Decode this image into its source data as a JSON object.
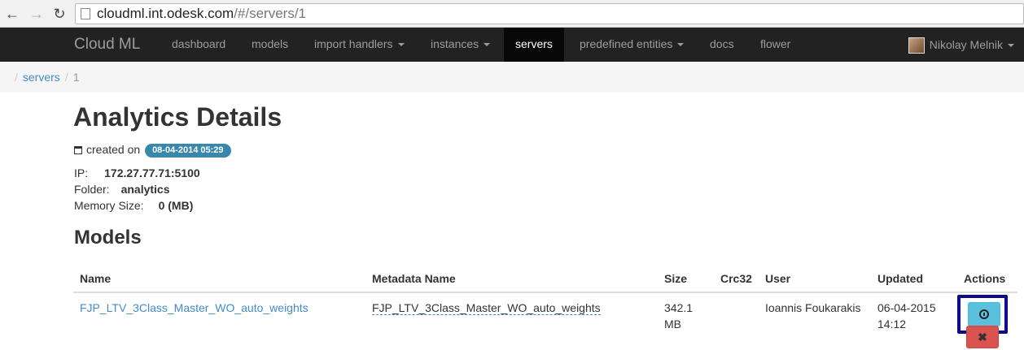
{
  "browser": {
    "url_host": "cloudml.int.odesk.com",
    "url_path": "/#/servers/1"
  },
  "navbar": {
    "brand": "Cloud ML",
    "items": [
      {
        "label": "dashboard"
      },
      {
        "label": "models"
      },
      {
        "label": "import handlers"
      },
      {
        "label": "instances"
      },
      {
        "label": "servers"
      },
      {
        "label": "predefined entities"
      },
      {
        "label": "docs"
      },
      {
        "label": "flower"
      }
    ],
    "user": "Nikolay Melnik"
  },
  "breadcrumb": {
    "link": "servers",
    "current": "1"
  },
  "page": {
    "title": "Analytics Details",
    "created_label": "created on",
    "created_date": "08-04-2014 05:29",
    "ip_label": "IP:",
    "ip": "172.27.77.71:5100",
    "folder_label": "Folder:",
    "folder": "analytics",
    "memory_label": "Memory Size:",
    "memory": "0 (MB)",
    "models_heading": "Models"
  },
  "table": {
    "headers": [
      "Name",
      "Metadata Name",
      "Size",
      "Crc32",
      "User",
      "Updated",
      "Actions"
    ],
    "rows": [
      {
        "name": "FJP_LTV_3Class_Master_WO_auto_weights",
        "metadata_name": "FJP_LTV_3Class_Master_WO_auto_weights",
        "size_line1": "342.1",
        "size_line2": "MB",
        "crc32": "",
        "user": "Ioannis Foukarakis",
        "updated_line1": "06-04-2015",
        "updated_line2": "14:12",
        "delete_symbol": "✖"
      }
    ]
  }
}
